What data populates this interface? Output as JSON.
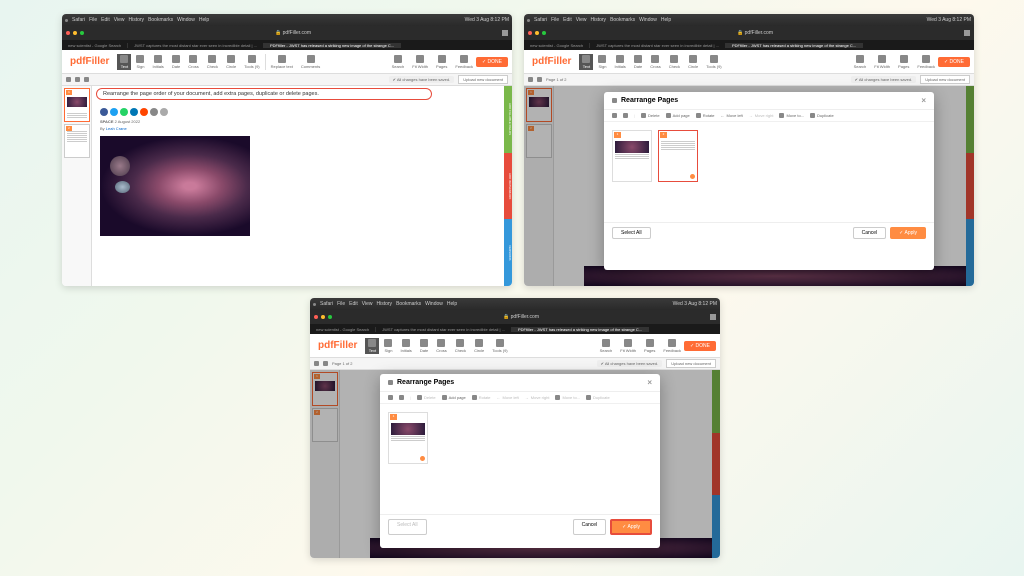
{
  "mac_menubar": {
    "app": "Safari",
    "menus": [
      "File",
      "Edit",
      "View",
      "History",
      "Bookmarks",
      "Window",
      "Help"
    ],
    "clock": "Wed 3 Aug 8:12 PM"
  },
  "browser": {
    "url": "pdfFiller.com",
    "tabs": [
      "new scientist - Google Search",
      "JWST captures the most distant star ever seen in incredible detail | ...",
      "PDFfiller - JWST has released a striking new image of the strange C..."
    ]
  },
  "app": {
    "logo": "pdfFiller",
    "toolbar": [
      "Text",
      "Sign",
      "Initials",
      "Date",
      "Cross",
      "Check",
      "Circle",
      "Tools (9)",
      "Replace text",
      "Comments",
      "Search",
      "Fit Width",
      "Pages",
      "Feedback"
    ],
    "done": "DONE",
    "save_status": "All changes have been saved.",
    "upload": "Upload new document",
    "page_indicator": "Page 1 of 2"
  },
  "callout_text": "Rearrange the page order of your document, add extra pages, duplicate or delete pages.",
  "article": {
    "category": "SPACE",
    "date": "2 August 2022",
    "byline_prefix": "By",
    "byline_author": "Leah Crane"
  },
  "right_tabs": [
    "ADD FILLABLE FIELDS",
    "ADD WATERMARK",
    "VERSIONS"
  ],
  "modal": {
    "title": "Rearrange Pages",
    "tools": {
      "delete": "Delete",
      "add_page": "Add page",
      "rotate": "Rotate",
      "move_left": "Move left",
      "move_right": "Move right",
      "move_to": "Move to...",
      "duplicate": "Duplicate"
    },
    "select_all": "Select All",
    "cancel": "Cancel",
    "apply": "Apply"
  }
}
